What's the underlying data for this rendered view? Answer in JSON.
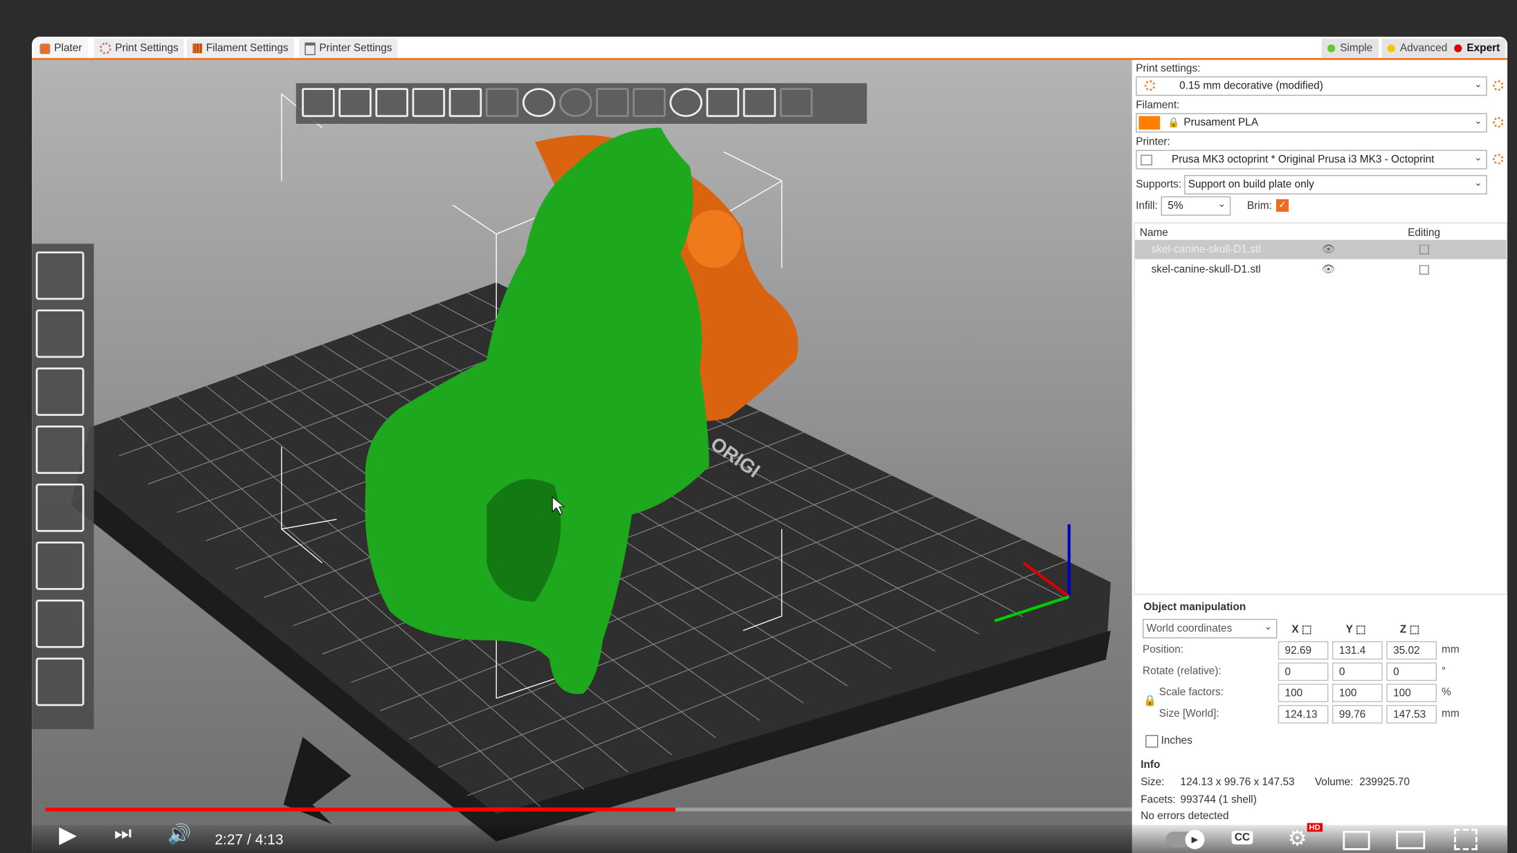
{
  "tabs": [
    {
      "label": "Plater",
      "active": true
    },
    {
      "label": "Print Settings"
    },
    {
      "label": "Filament Settings"
    },
    {
      "label": "Printer Settings"
    }
  ],
  "modes": [
    {
      "label": "Simple",
      "color": "#5fc72f"
    },
    {
      "label": "Advanced",
      "color": "#f7c600"
    },
    {
      "label": "Expert",
      "color": "#e00000",
      "active": true
    }
  ],
  "toolbar_icons": [
    "add-icon",
    "delete-icon",
    "delete-all-icon",
    "arrange-icon",
    "copy-icon",
    "paste-icon",
    "add-instance-icon",
    "remove-instance-icon",
    "split-objects-icon",
    "split-parts-icon",
    "search-icon",
    "layers-icon",
    "undo-icon",
    "redo-icon"
  ],
  "left_tools": [
    "move-icon",
    "scale-icon",
    "rotate-icon",
    "place-on-face-icon",
    "cut-icon",
    "support-paint-icon",
    "seam-paint-icon",
    "measure-icon"
  ],
  "panel": {
    "print_settings_label": "Print settings:",
    "print_settings_value": "0.15 mm decorative (modified)",
    "filament_label": "Filament:",
    "filament_value": "Prusament PLA",
    "filament_color": "#ff8000",
    "printer_label": "Printer:",
    "printer_value": "Prusa MK3 octoprint * Original Prusa i3 MK3 - Octoprint",
    "supports_label": "Supports:",
    "supports_value": "Support on build plate only",
    "infill_label": "Infill:",
    "infill_value": "5%",
    "brim_label": "Brim:",
    "brim_checked": true,
    "list_headers": {
      "name": "Name",
      "editing": "Editing"
    },
    "objects": [
      {
        "name": "skel-canine-skull-D1.stl",
        "selected": true
      },
      {
        "name": "skel-canine-skull-D1.stl",
        "selected": false
      }
    ]
  },
  "manip": {
    "title": "Object manipulation",
    "coord_mode": "World coordinates",
    "axes": [
      "X",
      "Y",
      "Z"
    ],
    "rows": [
      {
        "label": "Position:",
        "values": [
          "92.69",
          "131.4",
          "35.02"
        ],
        "unit": "mm"
      },
      {
        "label": "Rotate (relative):",
        "values": [
          "0",
          "0",
          "0"
        ],
        "unit": "°"
      },
      {
        "label": "Scale factors:",
        "values": [
          "100",
          "100",
          "100"
        ],
        "unit": "%"
      },
      {
        "label": "Size [World]:",
        "values": [
          "124.13",
          "99.76",
          "147.53"
        ],
        "unit": "mm"
      }
    ],
    "inches_label": "Inches",
    "inches_checked": false
  },
  "info": {
    "title": "Info",
    "size_label": "Size:",
    "size_value": "124.13 x 99.76 x 147.53",
    "volume_label": "Volume:",
    "volume_value": "239925.70",
    "facets_label": "Facets:",
    "facets_value": "993744 (1 shell)",
    "errors": "No errors detected"
  },
  "plate_text": "ORIGI",
  "video": {
    "time": "2:27 / 4:13",
    "progress": 0.58,
    "hd_badge": "HD",
    "cc": "CC"
  }
}
